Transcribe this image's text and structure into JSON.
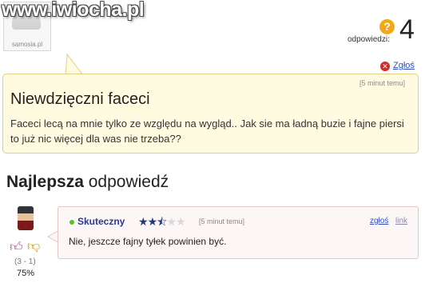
{
  "watermark": "www.iwiocha.pl",
  "asker": {
    "avatar_caption": "samosia.pl"
  },
  "stats": {
    "answers_label": "odpowiedzi:",
    "answers_count": "4"
  },
  "question": {
    "report_label": "Zgłoś",
    "time": "[5 minut temu]",
    "title": "Niewdzięczni faceci",
    "body": "Faceci lecą na mnie tylko ze względu na wygląd.. Jak sie ma ładną buzie i fajne piersi to już nic więcej dla was nie trzeba??"
  },
  "best_answer": {
    "heading_bold": "Najlepsza",
    "heading_rest": "odpowiedź",
    "user": "Skuteczny",
    "rating": 2.5,
    "rating_max": 5,
    "time": "[5 minut temu]",
    "report_label": "zgłoś",
    "link_label": "link",
    "body": "Nie, jeszcze fajny tyłek powinien być.",
    "vote_score": "(3 - 1)",
    "vote_percent": "75%"
  },
  "colors": {
    "question_bg": "#fffbe0",
    "answer_bg": "#fdf6f6",
    "link": "#2a4fbf",
    "question_icon": "#f2a81b",
    "username": "#2a3a8f"
  }
}
